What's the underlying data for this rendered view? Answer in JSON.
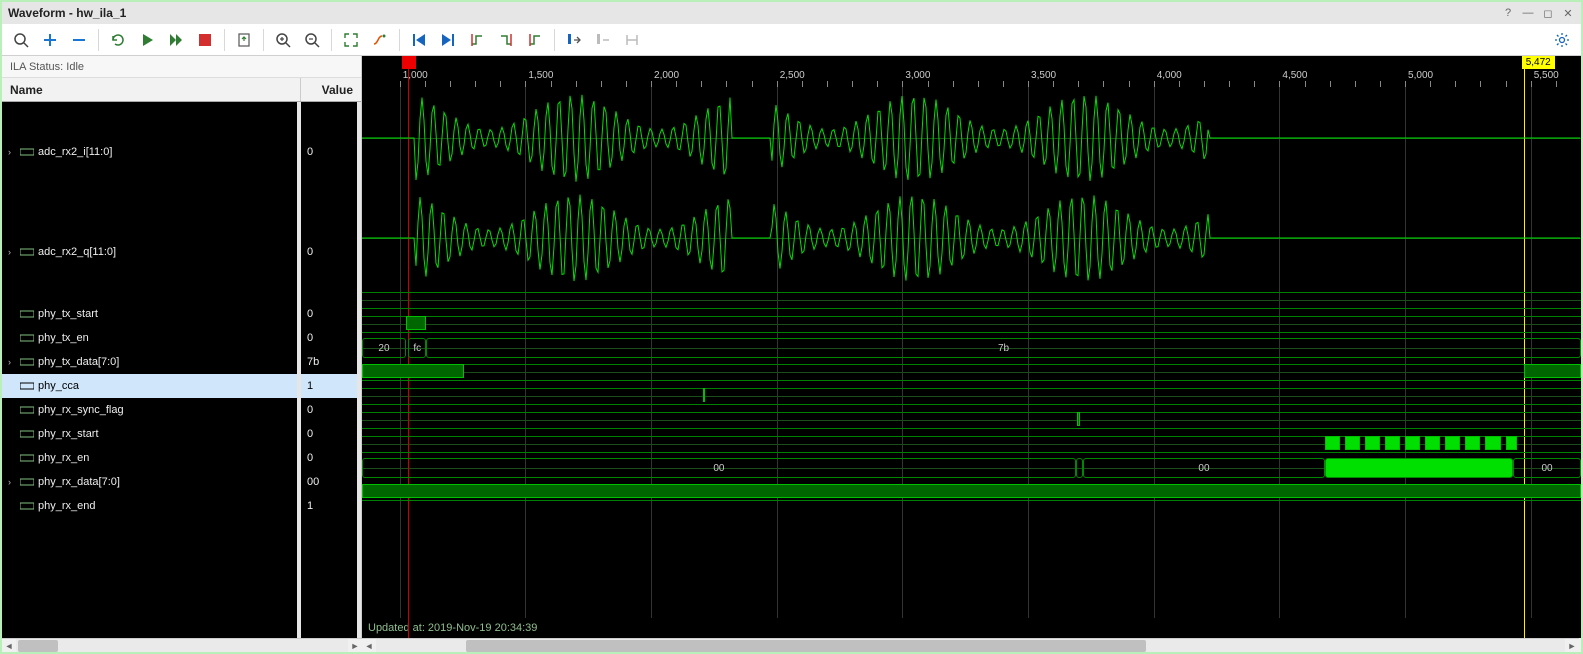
{
  "window": {
    "title": "Waveform - hw_ila_1"
  },
  "status": {
    "label": "ILA Status:",
    "value": "Idle"
  },
  "headers": {
    "name": "Name",
    "value": "Value"
  },
  "signals": [
    {
      "name": "adc_rx2_i[11:0]",
      "value": "0",
      "expandable": true,
      "height": "big",
      "icon": "bus-icon"
    },
    {
      "name": "adc_rx2_q[11:0]",
      "value": "0",
      "expandable": true,
      "height": "big",
      "icon": "bus-icon"
    },
    {
      "name": "phy_tx_start",
      "value": "0",
      "expandable": false,
      "height": "small",
      "icon": "wire-icon"
    },
    {
      "name": "phy_tx_en",
      "value": "0",
      "expandable": false,
      "height": "small",
      "icon": "wire-icon"
    },
    {
      "name": "phy_tx_data[7:0]",
      "value": "7b",
      "expandable": true,
      "height": "small",
      "icon": "bus-icon"
    },
    {
      "name": "phy_cca",
      "value": "1",
      "expandable": false,
      "height": "small",
      "icon": "wire-icon",
      "selected": true
    },
    {
      "name": "phy_rx_sync_flag",
      "value": "0",
      "expandable": false,
      "height": "small",
      "icon": "wire-icon"
    },
    {
      "name": "phy_rx_start",
      "value": "0",
      "expandable": false,
      "height": "small",
      "icon": "wire-icon"
    },
    {
      "name": "phy_rx_en",
      "value": "0",
      "expandable": false,
      "height": "small",
      "icon": "wire-icon"
    },
    {
      "name": "phy_rx_data[7:0]",
      "value": "00",
      "expandable": true,
      "height": "small",
      "icon": "bus-icon"
    },
    {
      "name": "phy_rx_end",
      "value": "1",
      "expandable": false,
      "height": "small",
      "icon": "wire-icon"
    }
  ],
  "timeline": {
    "start": 850,
    "end": 5700,
    "major_ticks": [
      1000,
      1500,
      2000,
      2500,
      3000,
      3500,
      4000,
      4500,
      5000,
      5500
    ],
    "tick_labels": [
      "1,000",
      "1,500",
      "2,000",
      "2,500",
      "3,000",
      "3,500",
      "4,000",
      "4,500",
      "5,000",
      "5,500"
    ],
    "cursor_primary": 1035,
    "cursor_secondary": 5472,
    "cursor_secondary_label": "5,472"
  },
  "bus_segments": {
    "phy_tx_data": [
      {
        "label": "20",
        "from": 850,
        "to": 1025
      },
      {
        "label": "fc",
        "from": 1035,
        "to": 1105
      },
      {
        "label": "7b",
        "from": 1105,
        "to": 5700
      }
    ],
    "phy_rx_data": [
      {
        "label": "00",
        "from": 850,
        "to": 3690
      },
      {
        "label": "",
        "from": 3690,
        "to": 3720
      },
      {
        "label": "00",
        "from": 3720,
        "to": 4680
      },
      {
        "label": "",
        "from": 4680,
        "to": 5430,
        "bright": true
      },
      {
        "label": "00",
        "from": 5430,
        "to": 5700
      }
    ]
  },
  "digital": {
    "phy_tx_en": {
      "high": [
        [
          1025,
          1105
        ]
      ]
    },
    "phy_cca": {
      "high": [
        [
          850,
          1255
        ],
        [
          5472,
          5700
        ]
      ]
    },
    "phy_rx_sync_flag": {
      "high": [
        [
          2205,
          2212
        ]
      ]
    },
    "phy_rx_start": {
      "high": [
        [
          3695,
          3705
        ]
      ]
    },
    "phy_rx_en": {
      "high": [
        [
          4680,
          4740
        ],
        [
          4760,
          4820
        ],
        [
          4840,
          4900
        ],
        [
          4920,
          4980
        ],
        [
          5000,
          5060
        ],
        [
          5080,
          5140
        ],
        [
          5160,
          5220
        ],
        [
          5240,
          5300
        ],
        [
          5320,
          5380
        ],
        [
          5400,
          5445
        ]
      ]
    }
  },
  "footer": {
    "updated": "Updated at: 2019-Nov-19 20:34:39"
  },
  "toolbar_icons": [
    "search",
    "plus",
    "minus",
    "refresh",
    "play",
    "fast-forward",
    "stop-record",
    "export",
    "zoom-in",
    "zoom-out",
    "fit",
    "snap",
    "first",
    "last",
    "prev-edge",
    "next-edge",
    "prev-trans",
    "swap",
    "marker-a",
    "marker-b"
  ],
  "settings_icon": "gear"
}
